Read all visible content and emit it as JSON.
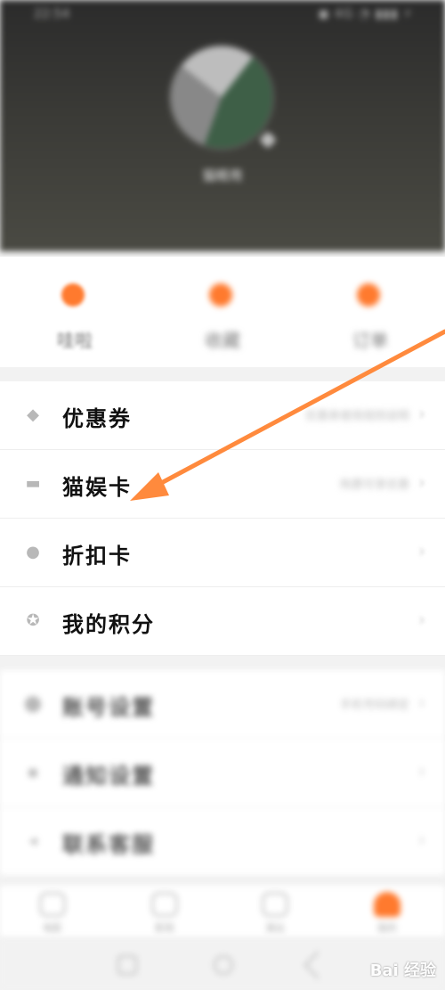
{
  "status_bar": {
    "time": "22:54",
    "icons": "◼ 4G ◔ ▮▮▮ ⚡"
  },
  "profile": {
    "nickname": "猫眼用"
  },
  "quick_actions": [
    {
      "label": "哇啦",
      "icon": "orange-dot-icon",
      "color": "#ff7a2e"
    },
    {
      "label": "收藏",
      "icon": "orange-dot-icon",
      "color": "#ff7a2e"
    },
    {
      "label": "订单",
      "icon": "orange-dot-icon",
      "color": "#ff7a2e"
    }
  ],
  "card_list": [
    {
      "label": "优惠券",
      "icon": "tag-icon",
      "hint": "优惠券使用规则说明"
    },
    {
      "label": "猫娱卡",
      "icon": "card-icon",
      "hint": "购票可享优惠"
    },
    {
      "label": "折扣卡",
      "icon": "discount-icon",
      "hint": ""
    },
    {
      "label": "我的积分",
      "icon": "medal-icon",
      "hint": ""
    }
  ],
  "settings_list": [
    {
      "label": "账号设置",
      "icon": "location-icon",
      "hint": "手机号码绑定"
    },
    {
      "label": "通知设置",
      "icon": "bell-icon",
      "hint": ""
    },
    {
      "label": "联系客服",
      "icon": "service-icon",
      "hint": ""
    }
  ],
  "tabbar": [
    {
      "label": "电影",
      "active": false
    },
    {
      "label": "影院",
      "active": false
    },
    {
      "label": "演出",
      "active": false
    },
    {
      "label": "我的",
      "active": true
    }
  ],
  "watermark": "Bai 经验",
  "accent_color": "#ff7a2e"
}
